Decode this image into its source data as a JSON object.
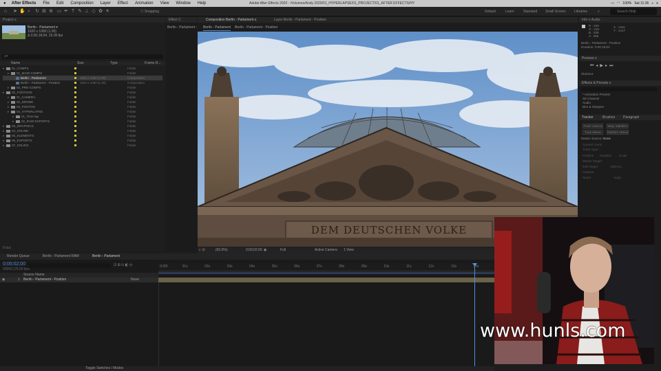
{
  "menubar": {
    "items": [
      "After Effects",
      "File",
      "Edit",
      "Composition",
      "Layer",
      "Effect",
      "Animation",
      "View",
      "Window",
      "Help"
    ],
    "doc_title": "Adobe After Effects 2020 - /Volumes/Andy 2020/01_HYPERLAPSE/01_PROJECT/01_AFTER EFFECTS/HYPERLAPSE.aep *",
    "status": [
      "100%",
      "Sat 11:36"
    ]
  },
  "toolbar": {
    "snapping_label": "Snapping",
    "workspaces": [
      "Default",
      "Learn",
      "Standard",
      "Small Screen",
      "Libraries"
    ],
    "search_placeholder": "Search Help"
  },
  "project_panel": {
    "tab": "Project  ≡",
    "selected_name": "Berlin - Parlament ▾",
    "selected_info1": "1920 x 1080 (1.00)",
    "selected_info2": "Δ 0;00;18;04, 25.00 fps",
    "search_placeholder": "ρ▾",
    "columns": [
      "Name",
      "",
      "Type",
      "Size",
      "Frame R..."
    ],
    "rows": [
      {
        "name": "01_COMPS",
        "type": "Folder",
        "size": "",
        "kind": "folder",
        "indent": 0
      },
      {
        "name": "01_MAIN COMPS",
        "type": "Folder",
        "size": "",
        "kind": "folder",
        "indent": 1
      },
      {
        "name": "Berlin - Parlament",
        "type": "Composition",
        "size": "1920 x 1080 (1.00)",
        "kind": "comp",
        "indent": 2
      },
      {
        "name": "Berlin - Parlament - Position",
        "type": "Composition",
        "size": "1920 x 1080 (1.00)",
        "kind": "comp",
        "indent": 2
      },
      {
        "name": "02_PRE-COMPS",
        "type": "Folder",
        "size": "",
        "kind": "folder",
        "indent": 1
      },
      {
        "name": "02_FOOTAGE",
        "type": "Folder",
        "size": "",
        "kind": "folder",
        "indent": 0
      },
      {
        "name": "01_CAMERA",
        "type": "Folder",
        "size": "",
        "kind": "folder",
        "indent": 1
      },
      {
        "name": "02_DRONE",
        "type": "Folder",
        "size": "",
        "kind": "folder",
        "indent": 1
      },
      {
        "name": "03_PHOTOS",
        "type": "Folder",
        "size": "",
        "kind": "folder",
        "indent": 1
      },
      {
        "name": "04_HYPERLAPSE",
        "type": "Folder",
        "size": "",
        "kind": "folder",
        "indent": 1
      },
      {
        "name": "01_Time lap",
        "type": "Folder",
        "size": "",
        "kind": "folder",
        "indent": 2
      },
      {
        "name": "02_RAW EXPORTS",
        "type": "Folder",
        "size": "",
        "kind": "folder",
        "indent": 2
      },
      {
        "name": "03_GRAPHICS",
        "type": "Folder",
        "size": "",
        "kind": "folder",
        "indent": 0
      },
      {
        "name": "04_SOUND",
        "type": "Folder",
        "size": "",
        "kind": "folder",
        "indent": 0
      },
      {
        "name": "05_ELEMENTS",
        "type": "Folder",
        "size": "",
        "kind": "folder",
        "indent": 0
      },
      {
        "name": "06_EXPORTS",
        "type": "Folder",
        "size": "",
        "kind": "folder",
        "indent": 0
      },
      {
        "name": "07_SOLIDS",
        "type": "Folder",
        "size": "",
        "kind": "folder",
        "indent": 0
      }
    ],
    "footer": "8 bpc"
  },
  "effect_panel": {
    "tab": "Effect C",
    "sub": "Berlin - Parlament - Po"
  },
  "viewer": {
    "tabs": [
      "Composition Berlin - Parlament ≡",
      "Layer  Berlin - Parlament - Position"
    ],
    "breadcrumbs": [
      "Berlin - Parlament",
      "Berlin - Parlament - Position"
    ],
    "inscription": "DEM DEUTSCHEN VOLKE",
    "zoom": "(60.0%)",
    "timecode": "0;00;02;00",
    "resolution": "Full",
    "camera": "Active Camera",
    "view": "1 View"
  },
  "timeline": {
    "tabs": [
      "Render Queue",
      "Berlin - Parlament RAW",
      "Berlin - Parlament"
    ],
    "timecode": "0;00;02;00",
    "fps": "00060 (25.00 fps)",
    "col_header": "Source Name",
    "layer_num": "1",
    "layer_name": "Berlin - Parlament - Position",
    "parent": "None",
    "ruler_labels": [
      "0;00f",
      "01s",
      "02s",
      "03s",
      "04s",
      "05s",
      "06s",
      "07s",
      "08s",
      "09s",
      "10s",
      "11s",
      "12s",
      "13s",
      "14s"
    ],
    "footer": "Toggle Switches / Modes"
  },
  "right_panel": {
    "info_tab": "Info  ≡   Audio",
    "info_lines": [
      "R : 220",
      "G : 216",
      "B : 208",
      "A : 255",
      "X : 1311",
      "Y : 1417"
    ],
    "info_text": [
      "Berlin - Parlament - Position",
      "Duration: 0;00;18;04",
      "In: 0;00;00;00, Out: 0;00;18;03"
    ],
    "preview_tab": "Preview  ≡",
    "shortcut_label": "Shortcut",
    "effects_tab": "Effects & Presets  ≡",
    "effects_items": [
      "* Animation Presets",
      "3D Channel",
      "Audio",
      "Blur & Sharpen"
    ],
    "tracker_tabs": [
      "Tracker",
      "Brushes",
      "Paragraph"
    ],
    "tracker_buttons": [
      "Track Camera",
      "Warp Stabilizer",
      "Track Motion",
      "Stabilize Motion"
    ],
    "motion_source_label": "Motion Source:",
    "motion_source_value": "None",
    "tracker_labels": [
      "Current Track:",
      "Track Type:",
      "Position",
      "Rotation",
      "Scale",
      "Motion Target:",
      "Edit Target",
      "Options...",
      "Analyze:",
      "Reset",
      "Apply"
    ]
  },
  "webcam": {
    "watermark": "www.hunls.com"
  }
}
